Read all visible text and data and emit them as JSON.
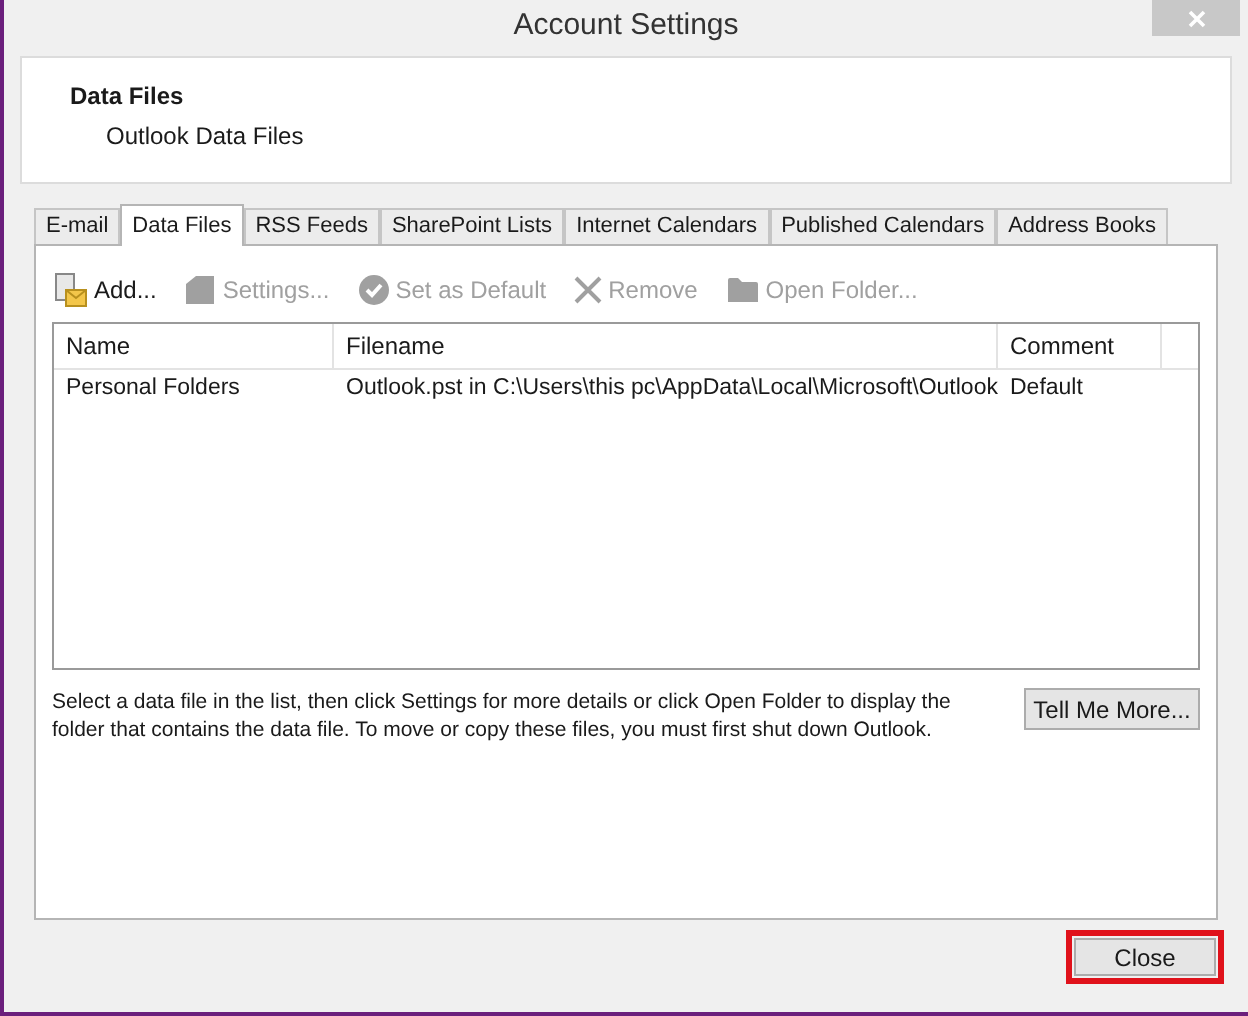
{
  "window": {
    "title": "Account Settings"
  },
  "header": {
    "title": "Data Files",
    "subtitle": "Outlook Data Files"
  },
  "tabs": [
    {
      "label": "E-mail",
      "selected": false
    },
    {
      "label": "Data Files",
      "selected": true
    },
    {
      "label": "RSS Feeds",
      "selected": false
    },
    {
      "label": "SharePoint Lists",
      "selected": false
    },
    {
      "label": "Internet Calendars",
      "selected": false
    },
    {
      "label": "Published Calendars",
      "selected": false
    },
    {
      "label": "Address Books",
      "selected": false
    }
  ],
  "toolbar": [
    {
      "kind": "add",
      "label": "Add...",
      "disabled": false
    },
    {
      "kind": "settings",
      "label": "Settings...",
      "disabled": true
    },
    {
      "kind": "default",
      "label": "Set as Default",
      "disabled": true
    },
    {
      "kind": "remove",
      "label": "Remove",
      "disabled": true
    },
    {
      "kind": "folder",
      "label": "Open Folder...",
      "disabled": true
    }
  ],
  "table": {
    "columns": [
      "Name",
      "Filename",
      "Comment"
    ],
    "rows": [
      [
        "Personal Folders",
        "Outlook.pst in C:\\Users\\this pc\\AppData\\Local\\Microsoft\\Outlook",
        "Default"
      ]
    ]
  },
  "description": "Select a data file in the list, then click Settings for more details or click Open Folder to display the folder that contains the data file. To move or copy these files, you must first shut down Outlook.",
  "tell_more_button": "Tell Me More...",
  "close_button": {
    "label": "Close",
    "highlighted": true
  }
}
